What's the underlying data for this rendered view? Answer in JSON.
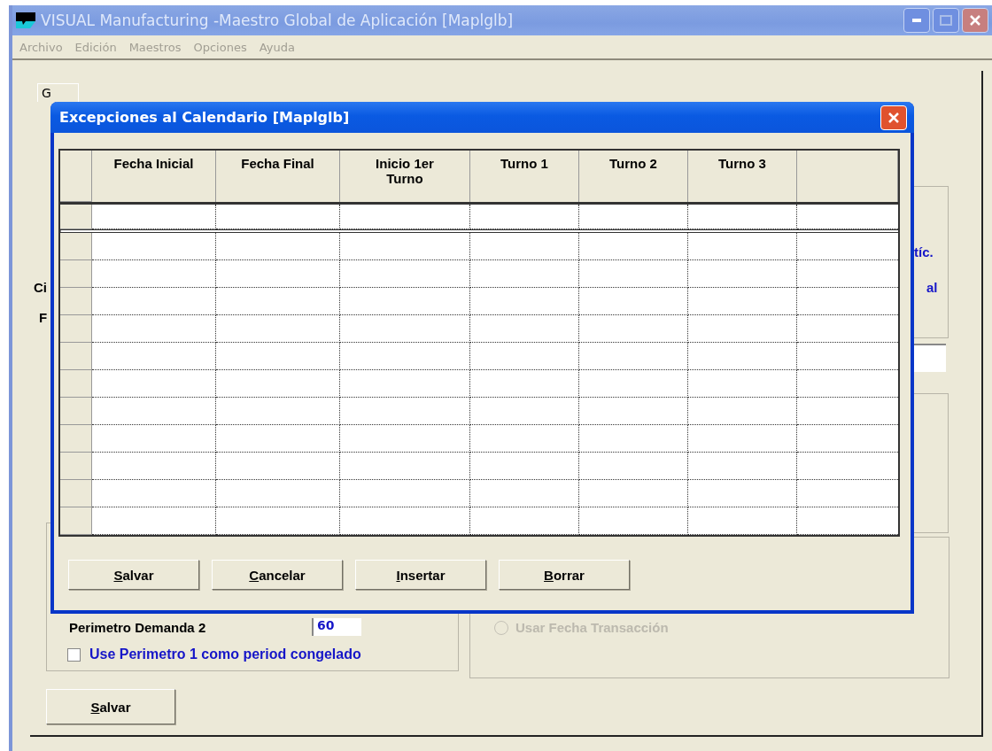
{
  "window": {
    "title": "VISUAL Manufacturing -Maestro Global de Aplicación [Maplglb]"
  },
  "menu": [
    {
      "label": "Archivo",
      "disabled": true
    },
    {
      "label": "Edición",
      "disabled": true
    },
    {
      "label": "Maestros",
      "disabled": true
    },
    {
      "label": "Opciones",
      "disabled": true
    },
    {
      "label": "Ayuda",
      "disabled": true
    }
  ],
  "form": {
    "tab_label": "G",
    "left_fragments": [
      "Ci",
      "F"
    ],
    "right_fragments": [
      "tíc.",
      "al"
    ],
    "demand_label": "Perimetro Demanda 2",
    "demand_value": "60",
    "freeze_checkbox": {
      "label": "Use Perimetro 1 como period congelado",
      "checked": false
    },
    "date_option": {
      "label": "Usar Fecha Transacción",
      "disabled": true
    },
    "save_button": "Salvar"
  },
  "dialog": {
    "title": "Excepciones al Calendario [Maplglb]",
    "columns": [
      "Fecha Inicial",
      "Fecha Final",
      "Inicio 1er Turno",
      "Turno 1",
      "Turno 2",
      "Turno 3"
    ],
    "buttons": [
      "Salvar",
      "Cancelar",
      "Insertar",
      "Borrar"
    ]
  }
}
